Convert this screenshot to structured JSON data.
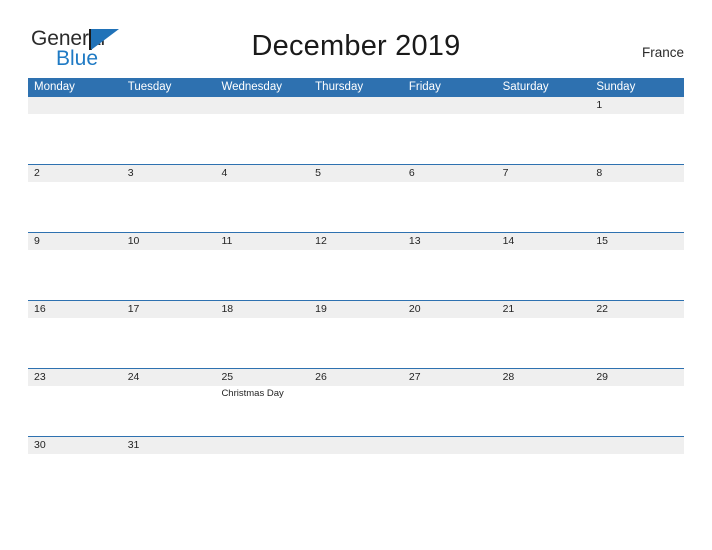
{
  "brand": {
    "name_part1": "General",
    "name_part2": "Blue",
    "color_dark": "#2b2b2b",
    "color_blue": "#1f7ac4"
  },
  "header": {
    "title": "December 2019",
    "country": "France"
  },
  "theme": {
    "header_blue": "#2e71b0",
    "band_gray": "#efefef",
    "row_border": "#2e71b0",
    "text_color": "#242424"
  },
  "calendar": {
    "month": "December",
    "year": "2019",
    "weekday_headers": [
      "Monday",
      "Tuesday",
      "Wednesday",
      "Thursday",
      "Friday",
      "Saturday",
      "Sunday"
    ],
    "weeks": [
      {
        "days": [
          {
            "number": "",
            "event": ""
          },
          {
            "number": "",
            "event": ""
          },
          {
            "number": "",
            "event": ""
          },
          {
            "number": "",
            "event": ""
          },
          {
            "number": "",
            "event": ""
          },
          {
            "number": "",
            "event": ""
          },
          {
            "number": "1",
            "event": ""
          }
        ]
      },
      {
        "days": [
          {
            "number": "2",
            "event": ""
          },
          {
            "number": "3",
            "event": ""
          },
          {
            "number": "4",
            "event": ""
          },
          {
            "number": "5",
            "event": ""
          },
          {
            "number": "6",
            "event": ""
          },
          {
            "number": "7",
            "event": ""
          },
          {
            "number": "8",
            "event": ""
          }
        ]
      },
      {
        "days": [
          {
            "number": "9",
            "event": ""
          },
          {
            "number": "10",
            "event": ""
          },
          {
            "number": "11",
            "event": ""
          },
          {
            "number": "12",
            "event": ""
          },
          {
            "number": "13",
            "event": ""
          },
          {
            "number": "14",
            "event": ""
          },
          {
            "number": "15",
            "event": ""
          }
        ]
      },
      {
        "days": [
          {
            "number": "16",
            "event": ""
          },
          {
            "number": "17",
            "event": ""
          },
          {
            "number": "18",
            "event": ""
          },
          {
            "number": "19",
            "event": ""
          },
          {
            "number": "20",
            "event": ""
          },
          {
            "number": "21",
            "event": ""
          },
          {
            "number": "22",
            "event": ""
          }
        ]
      },
      {
        "days": [
          {
            "number": "23",
            "event": ""
          },
          {
            "number": "24",
            "event": ""
          },
          {
            "number": "25",
            "event": "Christmas Day"
          },
          {
            "number": "26",
            "event": ""
          },
          {
            "number": "27",
            "event": ""
          },
          {
            "number": "28",
            "event": ""
          },
          {
            "number": "29",
            "event": ""
          }
        ]
      },
      {
        "days": [
          {
            "number": "30",
            "event": ""
          },
          {
            "number": "31",
            "event": ""
          },
          {
            "number": "",
            "event": ""
          },
          {
            "number": "",
            "event": ""
          },
          {
            "number": "",
            "event": ""
          },
          {
            "number": "",
            "event": ""
          },
          {
            "number": "",
            "event": ""
          }
        ]
      }
    ]
  }
}
